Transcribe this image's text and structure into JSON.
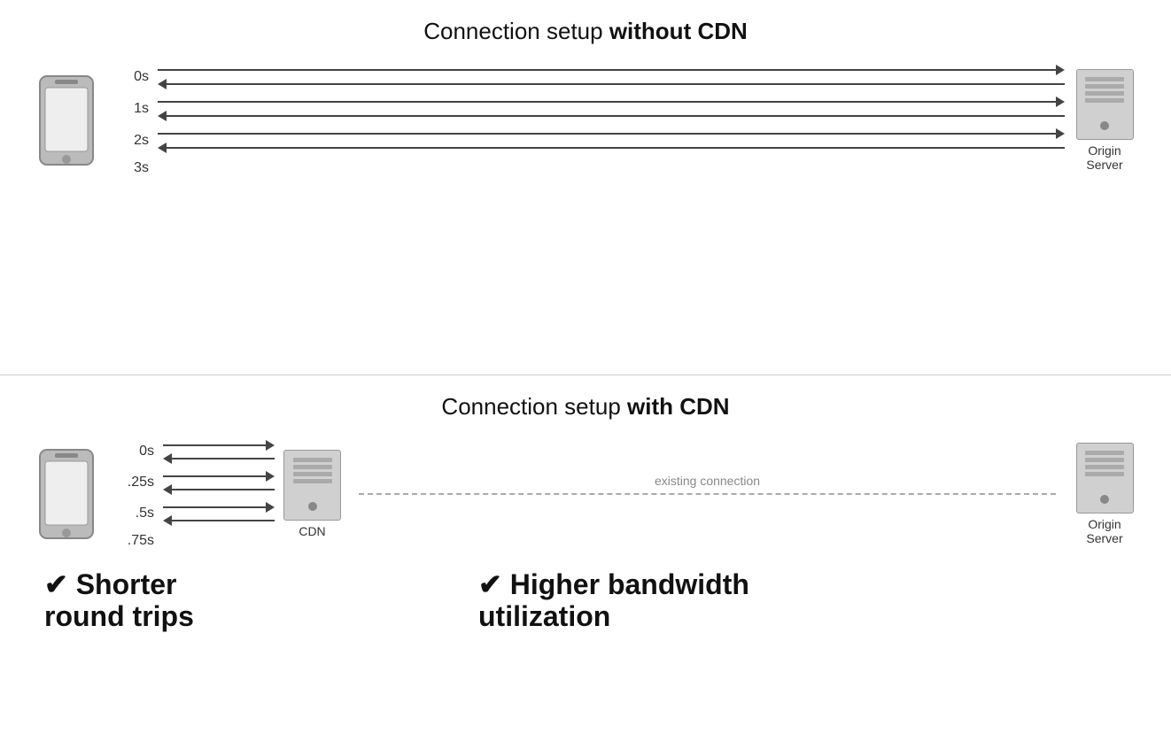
{
  "top_section": {
    "title_normal": "Connection setup ",
    "title_bold": "without CDN",
    "time_labels": [
      "0s",
      "1s",
      "2s",
      "3s"
    ],
    "server_label": "Origin\nServer"
  },
  "bottom_section": {
    "title_normal": "Connection setup ",
    "title_bold": "with CDN",
    "time_labels": [
      "0s",
      ".25s",
      ".5s",
      ".75s"
    ],
    "cdn_label": "CDN",
    "server_label": "Origin\nServer",
    "existing_connection": "existing connection",
    "benefit_left_check": "✔",
    "benefit_left_text": "Shorter\nround trips",
    "benefit_right_check": "✔",
    "benefit_right_text": "Higher bandwidth\nutilization"
  }
}
